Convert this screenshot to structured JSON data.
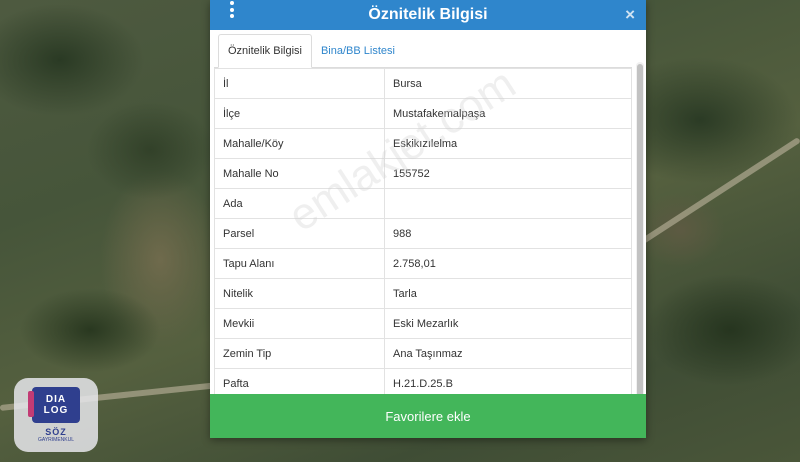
{
  "dialog": {
    "title": "Öznitelik Bilgisi",
    "close_label": "×",
    "menu_icon": "vertical-dots-icon",
    "tabs": [
      {
        "label": "Öznitelik Bilgisi",
        "active": true
      },
      {
        "label": "Bina/BB Listesi",
        "active": false
      }
    ],
    "rows": [
      {
        "key": "İl",
        "value": "Bursa"
      },
      {
        "key": "İlçe",
        "value": "Mustafakemalpaşa"
      },
      {
        "key": "Mahalle/Köy",
        "value": "Eskikızılelma"
      },
      {
        "key": "Mahalle No",
        "value": "155752"
      },
      {
        "key": "Ada",
        "value": ""
      },
      {
        "key": "Parsel",
        "value": "988"
      },
      {
        "key": "Tapu Alanı",
        "value": "2.758,01"
      },
      {
        "key": "Nitelik",
        "value": "Tarla"
      },
      {
        "key": "Mevkii",
        "value": "Eski Mezarlık"
      },
      {
        "key": "Zemin Tip",
        "value": "Ana Taşınmaz"
      },
      {
        "key": "Pafta",
        "value": "H.21.D.25.B"
      }
    ],
    "favorite_button": "Favorilere ekle"
  },
  "watermark": "emlakjet.com",
  "logo": {
    "line1": "DIA",
    "line2": "LOG",
    "name": "SÖZ",
    "sub": "GAYRIMENKUL"
  },
  "colors": {
    "header": "#2f86cc",
    "button": "#43b65a",
    "tab_link": "#2f86cc"
  }
}
